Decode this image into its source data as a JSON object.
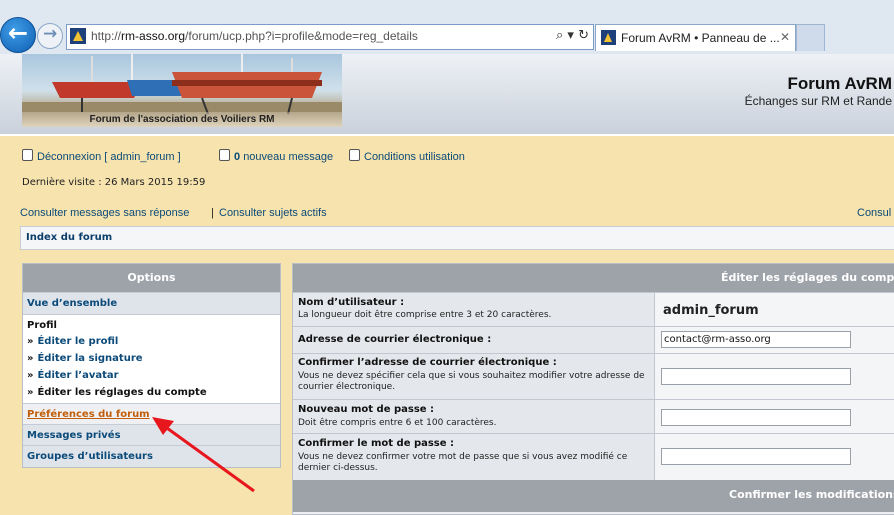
{
  "browser": {
    "url_prefix": "http://",
    "url_host": "rm-asso.org",
    "url_path": "/forum/ucp.php?i=profile&mode=reg_details",
    "search_glyph": "⌕",
    "dropdown_glyph": "▾",
    "refresh_glyph": "↻",
    "tab_title": "Forum AvRM • Panneau de ...",
    "tab_close": "✕",
    "back_glyph": "←",
    "forward_glyph": "→"
  },
  "site": {
    "banner_caption": "Forum de l'association des Voiliers RM",
    "title": "Forum AvRM",
    "description": "Échanges sur RM et Rande"
  },
  "user_links": {
    "logout": "Déconnexion [ admin_forum ]",
    "new_messages_count": "0",
    "new_messages_label": "nouveau message",
    "terms": "Conditions utilisation",
    "last_visit": "Dernière visite : 26 Mars 2015 19:59"
  },
  "search_links": {
    "unanswered": "Consulter messages sans réponse",
    "separator": "|",
    "active": "Consulter sujets actifs",
    "right_cut": "Consul"
  },
  "breadcrumb": {
    "index": "Index du forum"
  },
  "options": {
    "header": "Options",
    "overview": "Vue d’ensemble",
    "profile_label": "Profil",
    "raquo": "»",
    "profile_items": [
      "Éditer le profil",
      "Éditer la signature",
      "Éditer l’avatar",
      "Éditer les réglages du compte"
    ],
    "forum_prefs": "Préférences du forum",
    "private_messages": "Messages privés",
    "user_groups": "Groupes d’utilisateurs"
  },
  "edit_panel": {
    "header": "Éditer les réglages du compte",
    "fields": [
      {
        "label": "Nom d’utilisateur :",
        "hint": "La longueur doit être comprise entre 3 et 20 caractères.",
        "value": "admin_forum"
      },
      {
        "label": "Adresse de courrier électronique :",
        "hint": "",
        "value": "contact@rm-asso.org"
      },
      {
        "label": "Confirmer l’adresse de courrier électronique :",
        "hint": "Vous ne devez spécifier cela que si vous souhaitez modifier votre adresse de courrier électronique.",
        "value": ""
      },
      {
        "label": "Nouveau mot de passe :",
        "hint": "Doit être compris entre 6 et 100 caractères.",
        "value": ""
      },
      {
        "label": "Confirmer le mot de passe :",
        "hint": "Vous ne devez confirmer votre mot de passe que si vous avez modifié ce dernier ci-dessus.",
        "value": ""
      }
    ],
    "confirm": "Confirmer les modifications"
  },
  "colors": {
    "page_bg": "#f7e3ad",
    "link": "#0b4a79",
    "active_link": "#c25e0a",
    "panel_header": "#9ea3aa",
    "annotation_arrow": "#e8161d"
  },
  "icons": [
    "back-arrow-icon",
    "forward-arrow-icon",
    "site-favicon-icon",
    "search-icon",
    "refresh-icon",
    "logout-icon",
    "message-icon",
    "terms-icon",
    "annotation-arrow"
  ]
}
